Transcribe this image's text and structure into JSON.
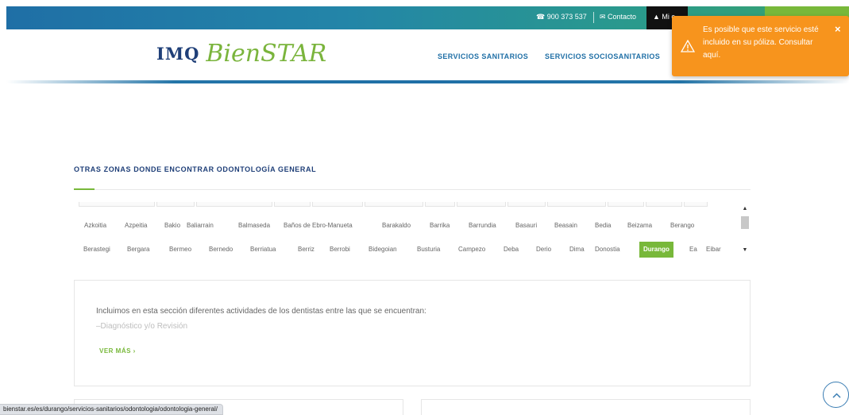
{
  "topbar": {
    "phone": "☎ 900 373 537",
    "contact": "✉ Contacto",
    "account": "▲ Mi c"
  },
  "logo": {
    "brand_bold": "IMQ",
    "brand_script": "BienSTAR"
  },
  "nav": [
    {
      "label": "SERVICIOS SANITARIOS"
    },
    {
      "label": "SERVICIOS SOCIOSANITARIOS"
    }
  ],
  "toast": {
    "message": "Es posible que este servicio esté incluido en su póliza. Consultar aquí.",
    "close": "×",
    "bg_color": "#f7941d"
  },
  "section": {
    "title": "OTRAS ZONAS DONDE ENCONTRAR ODONTOLOGÍA GENERAL"
  },
  "zones": {
    "row1": [
      "Azkoitia",
      "Azpeitia",
      "Bakio",
      "Baliarrain",
      "Balmaseda",
      "Baños de Ebro-Manueta",
      "Barakaldo",
      "Barrika",
      "Barrundia",
      "Basauri",
      "Beasain",
      "Bedia",
      "Beizama",
      "Berango"
    ],
    "row2": [
      "Berastegi",
      "Bergara",
      "Bermeo",
      "Bernedo",
      "Berriatua",
      "Berriz",
      "Berrobi",
      "Bidegoian",
      "Busturia",
      "Campezo",
      "Deba",
      "Derio",
      "Dima",
      "Donostia",
      "Durango",
      "Ea",
      "Eibar"
    ],
    "active": "Durango",
    "active_color": "#78b83a"
  },
  "info": {
    "text": "Incluimos en esta sección diferentes actividades de los dentistas entre las que se encuentran:",
    "sub": "–Diagnóstico y/o Revisión",
    "more": "VER MÁS ›"
  },
  "status_url": "bienstar.es/es/durango/servicios-sanitarios/odontologia/odontologia-general/",
  "colors": {
    "primary": "#1f6fa6",
    "accent_green": "#78b83a",
    "title_navy": "#1f3f78"
  }
}
